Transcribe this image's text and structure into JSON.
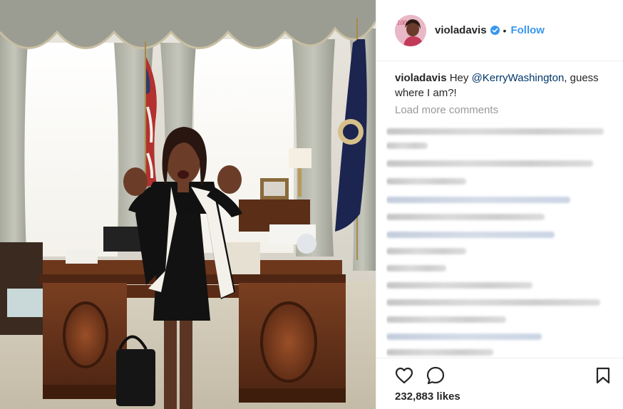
{
  "post": {
    "username": "violadavis",
    "follow_label": "Follow",
    "dot": "•",
    "caption": {
      "username": "violadavis",
      "text_before": "Hey ",
      "mention": "@KerryWashington",
      "text_after": ", guess where I am?!"
    },
    "load_more": "Load more comments",
    "likes": "232,883 likes"
  },
  "icons": {
    "verified": "verified-badge-icon",
    "like": "heart-icon",
    "comment": "comment-bubble-icon",
    "save": "bookmark-icon"
  },
  "colors": {
    "accent": "#3897f0",
    "text": "#262626",
    "muted": "#999999",
    "mention": "#003569"
  }
}
